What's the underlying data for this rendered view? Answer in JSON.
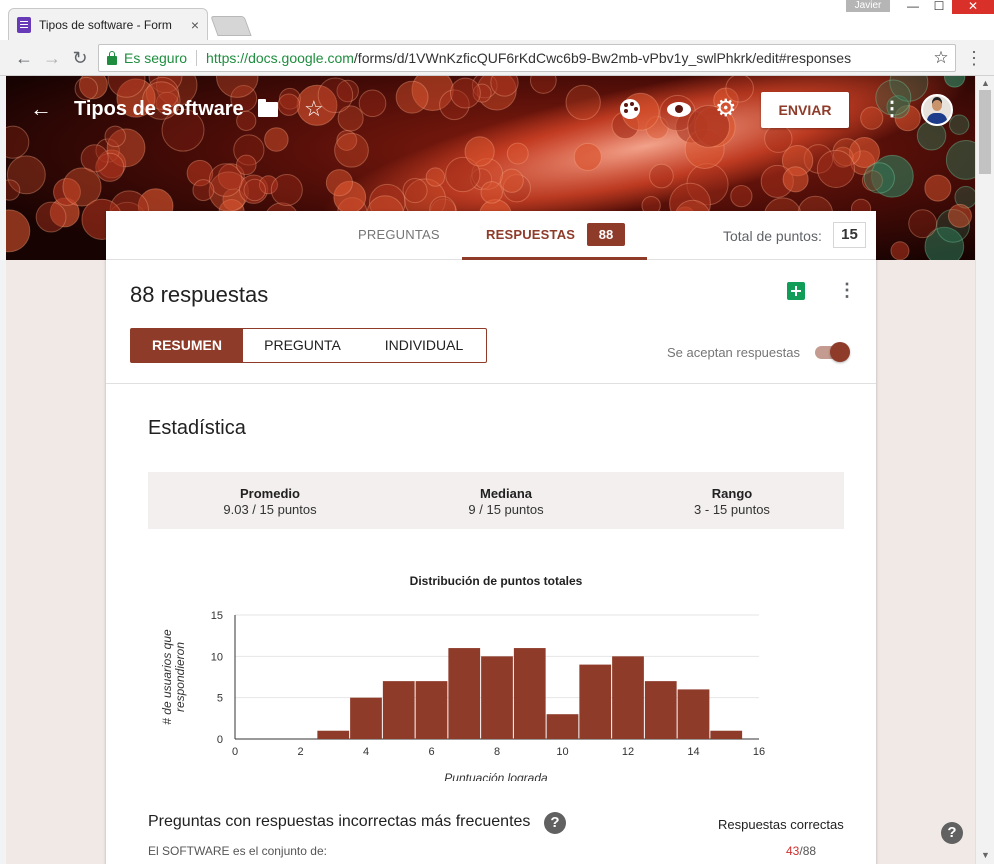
{
  "browser": {
    "tab_title": "Tipos de software - Form",
    "tab_close": "×",
    "user": "Javier",
    "url_secure_label": "Es seguro",
    "url_host": "https://docs.google.com",
    "url_path": "/forms/d/1VWnKzficQUF6rKdCwc6b9-Bw2mb-vPbv1y_swlPhkrk/edit#responses"
  },
  "header": {
    "form_title": "Tipos de software",
    "send_label": "ENVIAR"
  },
  "tabs": {
    "questions_label": "PREGUNTAS",
    "responses_label": "RESPUESTAS",
    "responses_count": "88",
    "total_points_label": "Total de puntos:",
    "total_points_value": "15"
  },
  "responses": {
    "heading": "88 respuestas",
    "views": [
      "RESUMEN",
      "PREGUNTA",
      "INDIVIDUAL"
    ],
    "accepting_label": "Se aceptan respuestas",
    "accepting": true
  },
  "stats": {
    "heading": "Estadística",
    "items": [
      {
        "label": "Promedio",
        "value": "9.03 / 15 puntos"
      },
      {
        "label": "Mediana",
        "value": "9 / 15 puntos"
      },
      {
        "label": "Rango",
        "value": "3 - 15 puntos"
      }
    ]
  },
  "chart_data": {
    "type": "bar",
    "title": "Distribución de puntos totales",
    "xlabel": "Puntuación lograda",
    "ylabel": "# de usuarios que respondieron",
    "xlim": [
      0,
      16
    ],
    "ylim": [
      0,
      15
    ],
    "x_ticks": [
      0,
      2,
      4,
      6,
      8,
      10,
      12,
      14,
      16
    ],
    "y_ticks": [
      0,
      5,
      10,
      15
    ],
    "grid": true,
    "bar_color": "#8e3b2a",
    "bins": [
      {
        "start": 2.5,
        "end": 3.5,
        "value": 1
      },
      {
        "start": 3.5,
        "end": 4.5,
        "value": 5
      },
      {
        "start": 4.5,
        "end": 5.5,
        "value": 7
      },
      {
        "start": 5.5,
        "end": 6.5,
        "value": 7
      },
      {
        "start": 6.5,
        "end": 7.5,
        "value": 11
      },
      {
        "start": 7.5,
        "end": 8.5,
        "value": 10
      },
      {
        "start": 8.5,
        "end": 9.5,
        "value": 11
      },
      {
        "start": 9.5,
        "end": 10.5,
        "value": 3
      },
      {
        "start": 10.5,
        "end": 11.5,
        "value": 9
      },
      {
        "start": 11.5,
        "end": 12.5,
        "value": 10
      },
      {
        "start": 12.5,
        "end": 13.5,
        "value": 7
      },
      {
        "start": 13.5,
        "end": 14.5,
        "value": 6
      },
      {
        "start": 14.5,
        "end": 15.5,
        "value": 1
      }
    ]
  },
  "faq": {
    "heading": "Preguntas con respuestas incorrectas más frecuentes",
    "correct_heading": "Respuestas correctas",
    "rows": [
      {
        "question": "El SOFTWARE es el conjunto de:",
        "correct": "43",
        "total": "/88"
      }
    ]
  },
  "theme": {
    "accent": "#8e3b2a",
    "accent_light": "#c49b90",
    "page_bg": "#f0e9e6",
    "sheets_green": "#0f9d58",
    "secure_green": "#1e8e3e"
  },
  "icons": [
    "back-arrow-icon",
    "folder-icon",
    "star-icon",
    "palette-icon",
    "eye-icon",
    "gear-icon",
    "more-vert-icon",
    "sheets-icon",
    "help-icon"
  ]
}
